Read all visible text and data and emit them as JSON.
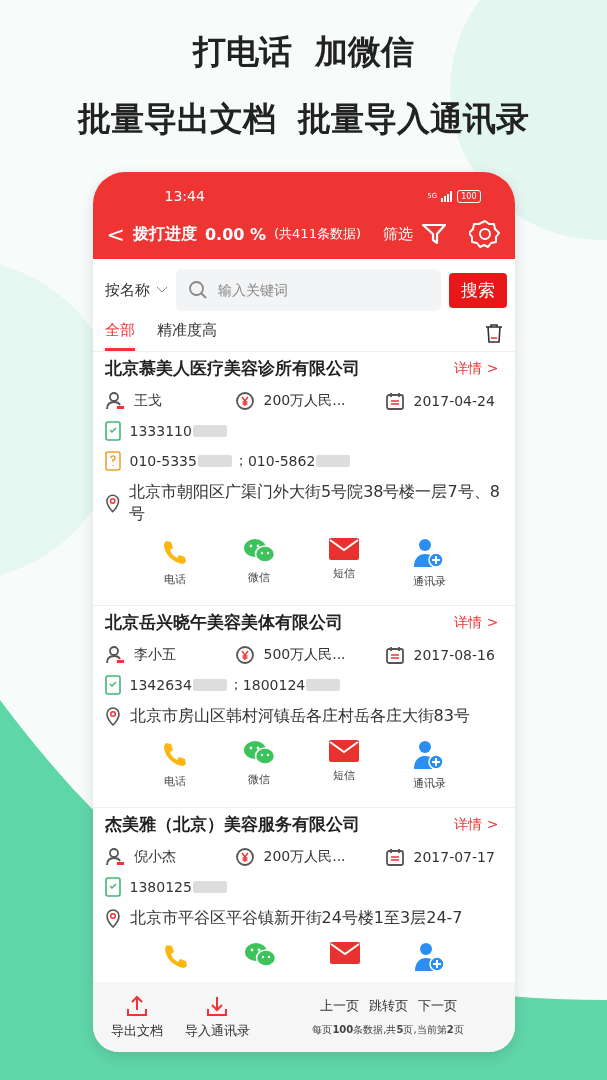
{
  "headline": [
    "打电话  加微信",
    "批量导出文档  批量导入通讯录"
  ],
  "status_bar": {
    "time": "13:44",
    "network": "5G",
    "battery": "100"
  },
  "header": {
    "back": "<",
    "title": "拨打进度",
    "progress": "0.00 %",
    "total": "(共411条数据)",
    "filter": "筛选"
  },
  "search": {
    "field_select": "按名称",
    "placeholder": "输入关键词",
    "button": "搜索"
  },
  "tabs": [
    {
      "label": "全部",
      "selected": true
    },
    {
      "label": "精准度高",
      "selected": false
    }
  ],
  "companies": [
    {
      "name": "北京慕美人医疗美容诊所有限公司",
      "details": "详情 >",
      "person": "王戈",
      "capital": "200万人民...",
      "date": "2017-04-24",
      "lines": [
        {
          "kind": "mobile",
          "numbers": [
            {
              "clear": "1333110",
              "masked": true
            }
          ]
        },
        {
          "kind": "landline",
          "separator": "；",
          "numbers": [
            {
              "clear": "010-5335",
              "masked": true
            },
            {
              "clear": "010-5862",
              "masked": true
            }
          ]
        },
        {
          "kind": "address",
          "text": "北京市朝阳区广渠门外大街5号院38号楼一层7号、8号"
        }
      ],
      "actions": [
        "电话",
        "微信",
        "短信",
        "通讯录"
      ]
    },
    {
      "name": "北京岳兴晓午美容美体有限公司",
      "details": "详情 >",
      "person": "李小五",
      "capital": "500万人民...",
      "date": "2017-08-16",
      "lines": [
        {
          "kind": "mobile",
          "separator": "；",
          "numbers": [
            {
              "clear": "1342634",
              "masked": true
            },
            {
              "clear": "1800124",
              "masked": true
            }
          ]
        },
        {
          "kind": "address",
          "text": "北京市房山区韩村河镇岳各庄村岳各庄大街83号"
        }
      ],
      "actions": [
        "电话",
        "微信",
        "短信",
        "通讯录"
      ]
    },
    {
      "name": "杰美雅（北京）美容服务有限公司",
      "details": "详情 >",
      "person": "倪小杰",
      "capital": "200万人民...",
      "date": "2017-07-17",
      "lines": [
        {
          "kind": "mobile",
          "numbers": [
            {
              "clear": "1380125",
              "masked": true
            }
          ]
        },
        {
          "kind": "address",
          "text": "北京市平谷区平谷镇新开街24号楼1至3层24-7"
        }
      ]
    }
  ],
  "bottom_bar": {
    "export": "导出文档",
    "import": "导入通讯录",
    "prev": "上一页",
    "jump": "跳转页",
    "next": "下一页",
    "page_info": "每页**100**条数据,共**5**页,当前第**2**页"
  }
}
